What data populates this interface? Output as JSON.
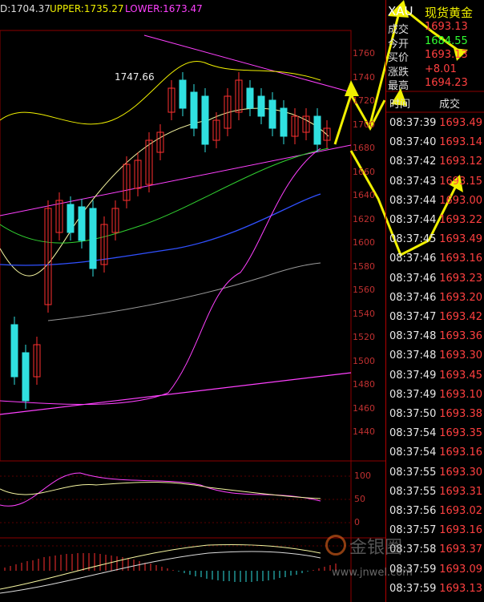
{
  "indicator": {
    "mid": "D:1704.37",
    "upper": "UPPER:1735.27",
    "lower": "LOWER:1673.47"
  },
  "peak_label": "1747.66",
  "y_axis_main": [
    "1760",
    "1740",
    "1720",
    "1700",
    "1680",
    "1660",
    "1640",
    "1620",
    "1600",
    "1580",
    "1560",
    "1540",
    "1520",
    "1500",
    "1480",
    "1460",
    "1440"
  ],
  "y_axis_sub1": [
    "100",
    "50",
    "0"
  ],
  "symbol": {
    "code": "XAU",
    "name": "现货黄金"
  },
  "quote": [
    {
      "key": "成交",
      "value": "1693.13",
      "color": "#ff4040"
    },
    {
      "key": "今开",
      "value": "1684.55",
      "color": "#30ff30"
    },
    {
      "key": "买价",
      "value": "1693.13",
      "color": "#ff4040"
    },
    {
      "key": "涨跌",
      "value": "+8.01",
      "color": "#ff4040"
    },
    {
      "key": "最高",
      "value": "1694.23",
      "color": "#ff4040"
    }
  ],
  "ticks_header": {
    "time": "时间",
    "price": "成交"
  },
  "ticks": [
    {
      "time": "08:37:39",
      "price": "1693.49"
    },
    {
      "time": "08:37:40",
      "price": "1693.14"
    },
    {
      "time": "08:37:42",
      "price": "1693.12"
    },
    {
      "time": "08:37:43",
      "price": "1693.15"
    },
    {
      "time": "08:37:44",
      "price": "1693.00"
    },
    {
      "time": "08:37:44",
      "price": "1693.22"
    },
    {
      "time": "08:37:45",
      "price": "1693.49"
    },
    {
      "time": "08:37:46",
      "price": "1693.16"
    },
    {
      "time": "08:37:46",
      "price": "1693.23"
    },
    {
      "time": "08:37:46",
      "price": "1693.20"
    },
    {
      "time": "08:37:47",
      "price": "1693.42"
    },
    {
      "time": "08:37:48",
      "price": "1693.36"
    },
    {
      "time": "08:37:48",
      "price": "1693.30"
    },
    {
      "time": "08:37:49",
      "price": "1693.45"
    },
    {
      "time": "08:37:49",
      "price": "1693.10"
    },
    {
      "time": "08:37:50",
      "price": "1693.38"
    },
    {
      "time": "08:37:54",
      "price": "1693.35"
    },
    {
      "time": "08:37:54",
      "price": "1693.16"
    },
    {
      "time": "08:37:55",
      "price": "1693.30"
    },
    {
      "time": "08:37:55",
      "price": "1693.31"
    },
    {
      "time": "08:37:56",
      "price": "1693.02"
    },
    {
      "time": "08:37:57",
      "price": "1693.16"
    },
    {
      "time": "08:37:58",
      "price": "1693.37"
    },
    {
      "time": "08:37:59",
      "price": "1693.09"
    },
    {
      "time": "08:37:59",
      "price": "1693.13"
    }
  ],
  "watermark": {
    "text": "金银圈",
    "url": "www.jnwel.com"
  },
  "colors": {
    "up": "#ff3030",
    "down": "#30e0e0",
    "bg": "#000000",
    "grid": "#8b0000",
    "arrow": "#f0f000"
  }
}
